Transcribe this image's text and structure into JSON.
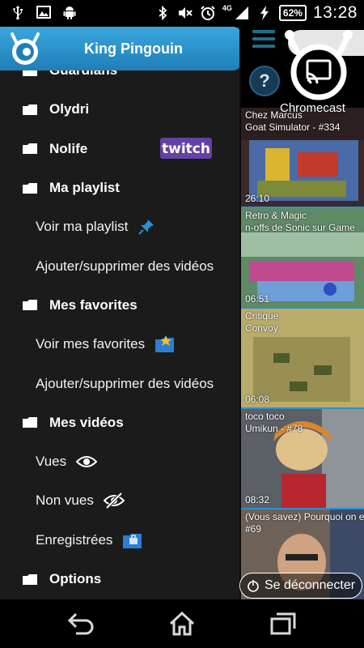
{
  "status_bar": {
    "network": "4G",
    "battery": "62%",
    "time": "13:28"
  },
  "drawer": {
    "title": "King Pingouin",
    "items": [
      {
        "label": "Guardians",
        "kind": "category"
      },
      {
        "label": "Olydri",
        "kind": "category"
      },
      {
        "label": "Nolife",
        "kind": "category",
        "badge": "twitch"
      },
      {
        "label": "Ma playlist",
        "kind": "category"
      },
      {
        "label": "Voir ma playlist",
        "kind": "sub",
        "icon": "pin-icon"
      },
      {
        "label": "Ajouter/supprimer des vidéos",
        "kind": "sub"
      },
      {
        "label": "Mes favorites",
        "kind": "category"
      },
      {
        "label": "Voir mes favorites",
        "kind": "sub",
        "icon": "favorites-folder-icon"
      },
      {
        "label": "Ajouter/supprimer des vidéos",
        "kind": "sub"
      },
      {
        "label": "Mes vidéos",
        "kind": "category"
      },
      {
        "label": "Vues",
        "kind": "sub",
        "icon": "eye-icon"
      },
      {
        "label": "Non vues",
        "kind": "sub",
        "icon": "eye-off-icon"
      },
      {
        "label": "Enregistrées",
        "kind": "sub",
        "icon": "saved-folder-icon"
      },
      {
        "label": "Options",
        "kind": "category"
      }
    ],
    "twitch_label": "twitch"
  },
  "main": {
    "help_label": "?",
    "cast_label": "Chromecast",
    "videos": [
      {
        "author": "Chez Marcus",
        "title": "Goat Simulator - #334",
        "duration": "26:10"
      },
      {
        "author": "Retro & Magic",
        "title": "n-offs de Sonic sur Game",
        "duration": "06:51"
      },
      {
        "author": "Critique",
        "title": "Convoy",
        "duration": "06:08"
      },
      {
        "author": "toco toco",
        "title": "Umikun - #78",
        "duration": "08:32"
      },
      {
        "author": "(Vous savez) Pourquoi on e",
        "title": "#69",
        "duration": ""
      }
    ],
    "disconnect_label": "Se déconnecter"
  },
  "colors": {
    "accent": "#2e8fcf",
    "header": "#2a93cd",
    "twitch": "#6441a5",
    "drawer_bg": "#1b1b1b"
  }
}
